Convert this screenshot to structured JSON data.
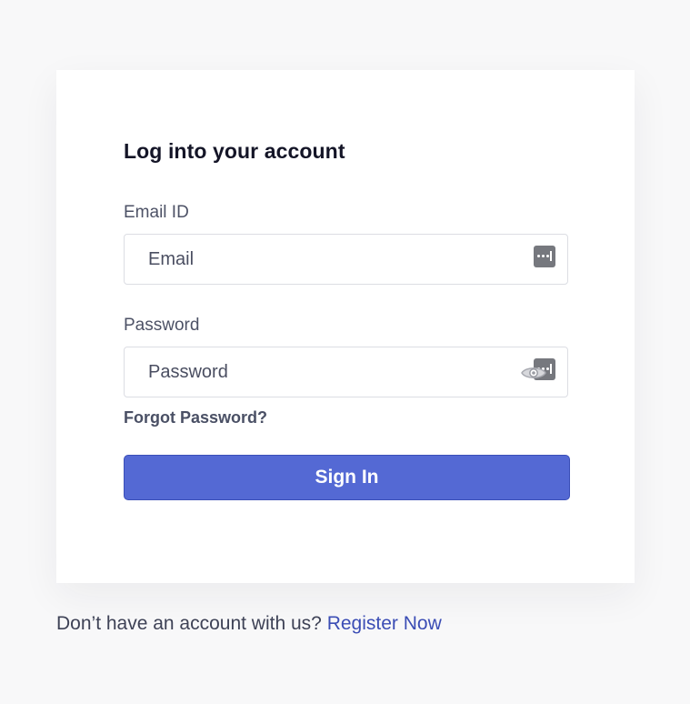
{
  "login": {
    "title": "Log into your account",
    "email_label": "Email ID",
    "email_placeholder": "Email",
    "email_value": "",
    "password_label": "Password",
    "password_placeholder": "Password",
    "password_value": "",
    "forgot_link": "Forgot Password?",
    "submit_label": "Sign In"
  },
  "footer": {
    "prompt": "Don’t have an account with us?",
    "register_link": "Register Now"
  },
  "icons": {
    "email_autofill": "password-manager-icon",
    "password_visibility": "eye-icon",
    "password_autofill": "password-manager-icon"
  },
  "colors": {
    "background": "#f8f8f9",
    "card": "#ffffff",
    "primary_button": "#5469d4",
    "link": "#3b4db5",
    "title_text": "#141527"
  }
}
